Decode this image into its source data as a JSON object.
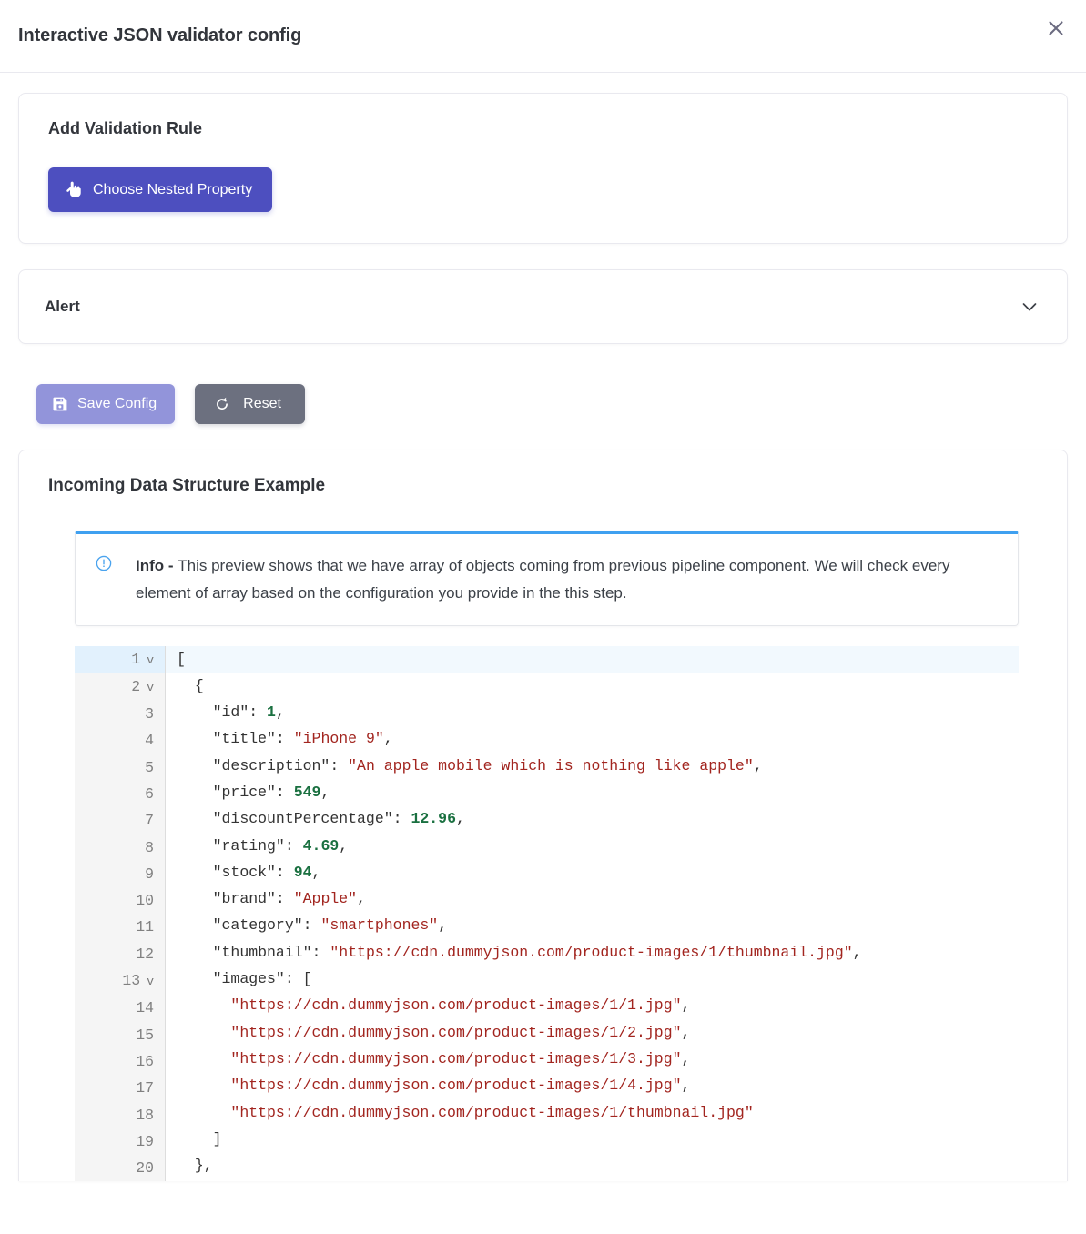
{
  "header": {
    "title": "Interactive JSON validator config",
    "close_icon": "close-icon"
  },
  "rule_card": {
    "title": "Add Validation Rule",
    "choose_button": {
      "label": "Choose Nested Property",
      "icon": "hand-pointing-up-icon",
      "color": "#4d4fbf"
    }
  },
  "accordion": {
    "label": "Alert",
    "chevron_icon": "chevron-down-icon",
    "expanded": false
  },
  "actions": {
    "save": {
      "label": "Save Config",
      "icon": "save-floppy-icon",
      "color": "#9294da"
    },
    "reset": {
      "label": "Reset",
      "icon": "reset-rotate-icon",
      "color": "#6c707f"
    }
  },
  "preview": {
    "title": "Incoming Data Structure Example",
    "info": {
      "icon": "info-circle-icon",
      "accent_color": "#3fa0f0",
      "label": "Info",
      "separator": " - ",
      "text": "This preview shows that we have array of objects coming from previous pipeline component. We will check every element of array based on the configuration you provide in the this step."
    },
    "editor": {
      "active_line": 1,
      "lines": [
        {
          "n": 1,
          "fold": "v",
          "indent": 0,
          "tokens": [
            {
              "t": "pun",
              "v": "["
            }
          ]
        },
        {
          "n": 2,
          "fold": "v",
          "indent": 1,
          "tokens": [
            {
              "t": "pun",
              "v": "{"
            }
          ]
        },
        {
          "n": 3,
          "fold": "",
          "indent": 2,
          "tokens": [
            {
              "t": "key",
              "v": "\"id\""
            },
            {
              "t": "pun",
              "v": ": "
            },
            {
              "t": "num",
              "v": "1"
            },
            {
              "t": "pun",
              "v": ","
            }
          ]
        },
        {
          "n": 4,
          "fold": "",
          "indent": 2,
          "tokens": [
            {
              "t": "key",
              "v": "\"title\""
            },
            {
              "t": "pun",
              "v": ": "
            },
            {
              "t": "str",
              "v": "\"iPhone 9\""
            },
            {
              "t": "pun",
              "v": ","
            }
          ]
        },
        {
          "n": 5,
          "fold": "",
          "indent": 2,
          "tokens": [
            {
              "t": "key",
              "v": "\"description\""
            },
            {
              "t": "pun",
              "v": ": "
            },
            {
              "t": "str",
              "v": "\"An apple mobile which is nothing like apple\""
            },
            {
              "t": "pun",
              "v": ","
            }
          ]
        },
        {
          "n": 6,
          "fold": "",
          "indent": 2,
          "tokens": [
            {
              "t": "key",
              "v": "\"price\""
            },
            {
              "t": "pun",
              "v": ": "
            },
            {
              "t": "num",
              "v": "549"
            },
            {
              "t": "pun",
              "v": ","
            }
          ]
        },
        {
          "n": 7,
          "fold": "",
          "indent": 2,
          "tokens": [
            {
              "t": "key",
              "v": "\"discountPercentage\""
            },
            {
              "t": "pun",
              "v": ": "
            },
            {
              "t": "num",
              "v": "12.96"
            },
            {
              "t": "pun",
              "v": ","
            }
          ]
        },
        {
          "n": 8,
          "fold": "",
          "indent": 2,
          "tokens": [
            {
              "t": "key",
              "v": "\"rating\""
            },
            {
              "t": "pun",
              "v": ": "
            },
            {
              "t": "num",
              "v": "4.69"
            },
            {
              "t": "pun",
              "v": ","
            }
          ]
        },
        {
          "n": 9,
          "fold": "",
          "indent": 2,
          "tokens": [
            {
              "t": "key",
              "v": "\"stock\""
            },
            {
              "t": "pun",
              "v": ": "
            },
            {
              "t": "num",
              "v": "94"
            },
            {
              "t": "pun",
              "v": ","
            }
          ]
        },
        {
          "n": 10,
          "fold": "",
          "indent": 2,
          "tokens": [
            {
              "t": "key",
              "v": "\"brand\""
            },
            {
              "t": "pun",
              "v": ": "
            },
            {
              "t": "str",
              "v": "\"Apple\""
            },
            {
              "t": "pun",
              "v": ","
            }
          ]
        },
        {
          "n": 11,
          "fold": "",
          "indent": 2,
          "tokens": [
            {
              "t": "key",
              "v": "\"category\""
            },
            {
              "t": "pun",
              "v": ": "
            },
            {
              "t": "str",
              "v": "\"smartphones\""
            },
            {
              "t": "pun",
              "v": ","
            }
          ]
        },
        {
          "n": 12,
          "fold": "",
          "indent": 2,
          "tokens": [
            {
              "t": "key",
              "v": "\"thumbnail\""
            },
            {
              "t": "pun",
              "v": ": "
            },
            {
              "t": "str",
              "v": "\"https://cdn.dummyjson.com/product-images/1/thumbnail.jpg\""
            },
            {
              "t": "pun",
              "v": ","
            }
          ]
        },
        {
          "n": 13,
          "fold": "v",
          "indent": 2,
          "tokens": [
            {
              "t": "key",
              "v": "\"images\""
            },
            {
              "t": "pun",
              "v": ": ["
            }
          ]
        },
        {
          "n": 14,
          "fold": "",
          "indent": 3,
          "tokens": [
            {
              "t": "str",
              "v": "\"https://cdn.dummyjson.com/product-images/1/1.jpg\""
            },
            {
              "t": "pun",
              "v": ","
            }
          ]
        },
        {
          "n": 15,
          "fold": "",
          "indent": 3,
          "tokens": [
            {
              "t": "str",
              "v": "\"https://cdn.dummyjson.com/product-images/1/2.jpg\""
            },
            {
              "t": "pun",
              "v": ","
            }
          ]
        },
        {
          "n": 16,
          "fold": "",
          "indent": 3,
          "tokens": [
            {
              "t": "str",
              "v": "\"https://cdn.dummyjson.com/product-images/1/3.jpg\""
            },
            {
              "t": "pun",
              "v": ","
            }
          ]
        },
        {
          "n": 17,
          "fold": "",
          "indent": 3,
          "tokens": [
            {
              "t": "str",
              "v": "\"https://cdn.dummyjson.com/product-images/1/4.jpg\""
            },
            {
              "t": "pun",
              "v": ","
            }
          ]
        },
        {
          "n": 18,
          "fold": "",
          "indent": 3,
          "tokens": [
            {
              "t": "str",
              "v": "\"https://cdn.dummyjson.com/product-images/1/thumbnail.jpg\""
            }
          ]
        },
        {
          "n": 19,
          "fold": "",
          "indent": 2,
          "tokens": [
            {
              "t": "pun",
              "v": "]"
            }
          ]
        },
        {
          "n": 20,
          "fold": "",
          "indent": 1,
          "tokens": [
            {
              "t": "pun",
              "v": "},"
            }
          ]
        }
      ]
    }
  }
}
